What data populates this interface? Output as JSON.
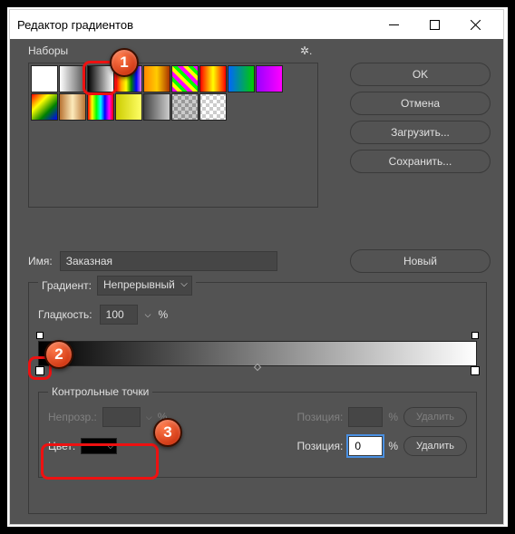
{
  "titlebar": {
    "title": "Редактор градиентов"
  },
  "presets": {
    "label": "Наборы"
  },
  "buttons": {
    "ok": "OK",
    "cancel": "Отмена",
    "load": "Загрузить...",
    "save": "Сохранить...",
    "new": "Новый",
    "delete": "Удалить"
  },
  "name": {
    "label": "Имя:",
    "value": "Заказная"
  },
  "gradient": {
    "label": "Градиент:",
    "type": "Непрерывный",
    "smoothness_label": "Гладкость:",
    "smoothness_value": "100",
    "percent": "%"
  },
  "control_points": {
    "legend": "Контрольные точки",
    "opacity_label": "Непрозр.:",
    "color_label": "Цвет:",
    "position_label": "Позиция:",
    "position_value": "0"
  },
  "callouts": {
    "b1": "1",
    "b2": "2",
    "b3": "3"
  }
}
